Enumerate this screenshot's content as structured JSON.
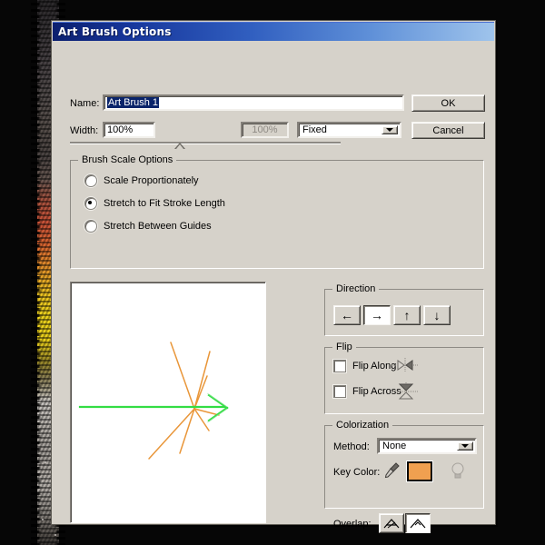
{
  "window": {
    "title": "Art Brush Options"
  },
  "name_row": {
    "label": "Name:",
    "value": "Art Brush 1",
    "placeholder": ""
  },
  "width_row": {
    "label": "Width:",
    "value": "100%",
    "secondary_value": "100%",
    "variation_method": "Fixed",
    "slider_percent": 50
  },
  "buttons": {
    "ok": "OK",
    "cancel": "Cancel"
  },
  "brush_scale": {
    "legend": "Brush Scale Options",
    "options": [
      {
        "label": "Scale Proportionately",
        "selected": false
      },
      {
        "label": "Stretch to Fit Stroke Length",
        "selected": true
      },
      {
        "label": "Stretch Between Guides",
        "selected": false
      }
    ]
  },
  "direction": {
    "legend": "Direction",
    "buttons": [
      {
        "icon": "arrow-left-icon",
        "glyph": "←",
        "selected": false
      },
      {
        "icon": "arrow-right-icon",
        "glyph": "→",
        "selected": true
      },
      {
        "icon": "arrow-up-icon",
        "glyph": "↑",
        "selected": false
      },
      {
        "icon": "arrow-down-icon",
        "glyph": "↓",
        "selected": false
      }
    ]
  },
  "flip": {
    "legend": "Flip",
    "options": [
      {
        "label": "Flip Along",
        "checked": false,
        "preview_icon": "flip-along-preview-icon"
      },
      {
        "label": "Flip Across",
        "checked": false,
        "preview_icon": "flip-across-preview-icon"
      }
    ]
  },
  "colorization": {
    "legend": "Colorization",
    "method_label": "Method:",
    "method_value": "None",
    "key_color_label": "Key Color:",
    "key_color": "#f0a050",
    "eyedropper_icon": "eyedropper-icon",
    "tip_icon": "lightbulb-icon"
  },
  "overlap": {
    "label": "Overlap:",
    "buttons": [
      {
        "icon": "overlap-allow-icon",
        "selected": false
      },
      {
        "icon": "overlap-prevent-icon",
        "selected": true
      }
    ]
  },
  "preview": {
    "name": "brush-preview",
    "stroke_color": "#33dd44",
    "spark_color": "#e8912f"
  },
  "colors": {
    "title_start": "#0b1f6e",
    "title_end": "#9fc4ec",
    "dialog_face": "#d6d2ca",
    "accent_orange": "#f0a050",
    "preview_green": "#33dd44"
  }
}
